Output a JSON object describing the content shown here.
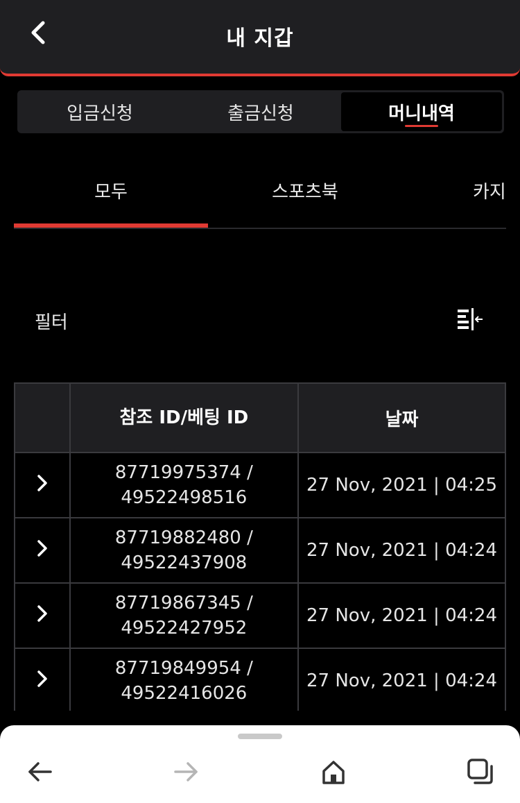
{
  "header": {
    "title": "내 지갑",
    "back_icon": "chevron-left-icon"
  },
  "segment": {
    "tabs": [
      "입금신청",
      "출금신청",
      "머니내역"
    ],
    "active_index": 2
  },
  "subtabs": {
    "tabs": [
      "모두",
      "스포츠북",
      "카지"
    ],
    "active_index": 0
  },
  "filter": {
    "label": "필터",
    "icon": "filter-collapse-icon"
  },
  "table": {
    "headers": [
      "",
      "참조 ID/베팅 ID",
      "날짜"
    ],
    "rows": [
      {
        "id_line1": "87719975374 /",
        "id_line2": "49522498516",
        "date": "27 Nov, 2021 | 04:25"
      },
      {
        "id_line1": "87719882480 /",
        "id_line2": "49522437908",
        "date": "27 Nov, 2021 | 04:24"
      },
      {
        "id_line1": "87719867345 /",
        "id_line2": "49522427952",
        "date": "27 Nov, 2021 | 04:24"
      },
      {
        "id_line1": "87719849954 /",
        "id_line2": "49522416026",
        "date": "27 Nov, 2021 | 04:24"
      }
    ]
  },
  "browser_nav": {
    "icons": [
      "back-arrow-icon",
      "forward-arrow-icon",
      "home-icon",
      "tabs-icon"
    ]
  },
  "colors": {
    "accent": "#e03a33",
    "panel": "#1f1f22",
    "background": "#000000"
  }
}
